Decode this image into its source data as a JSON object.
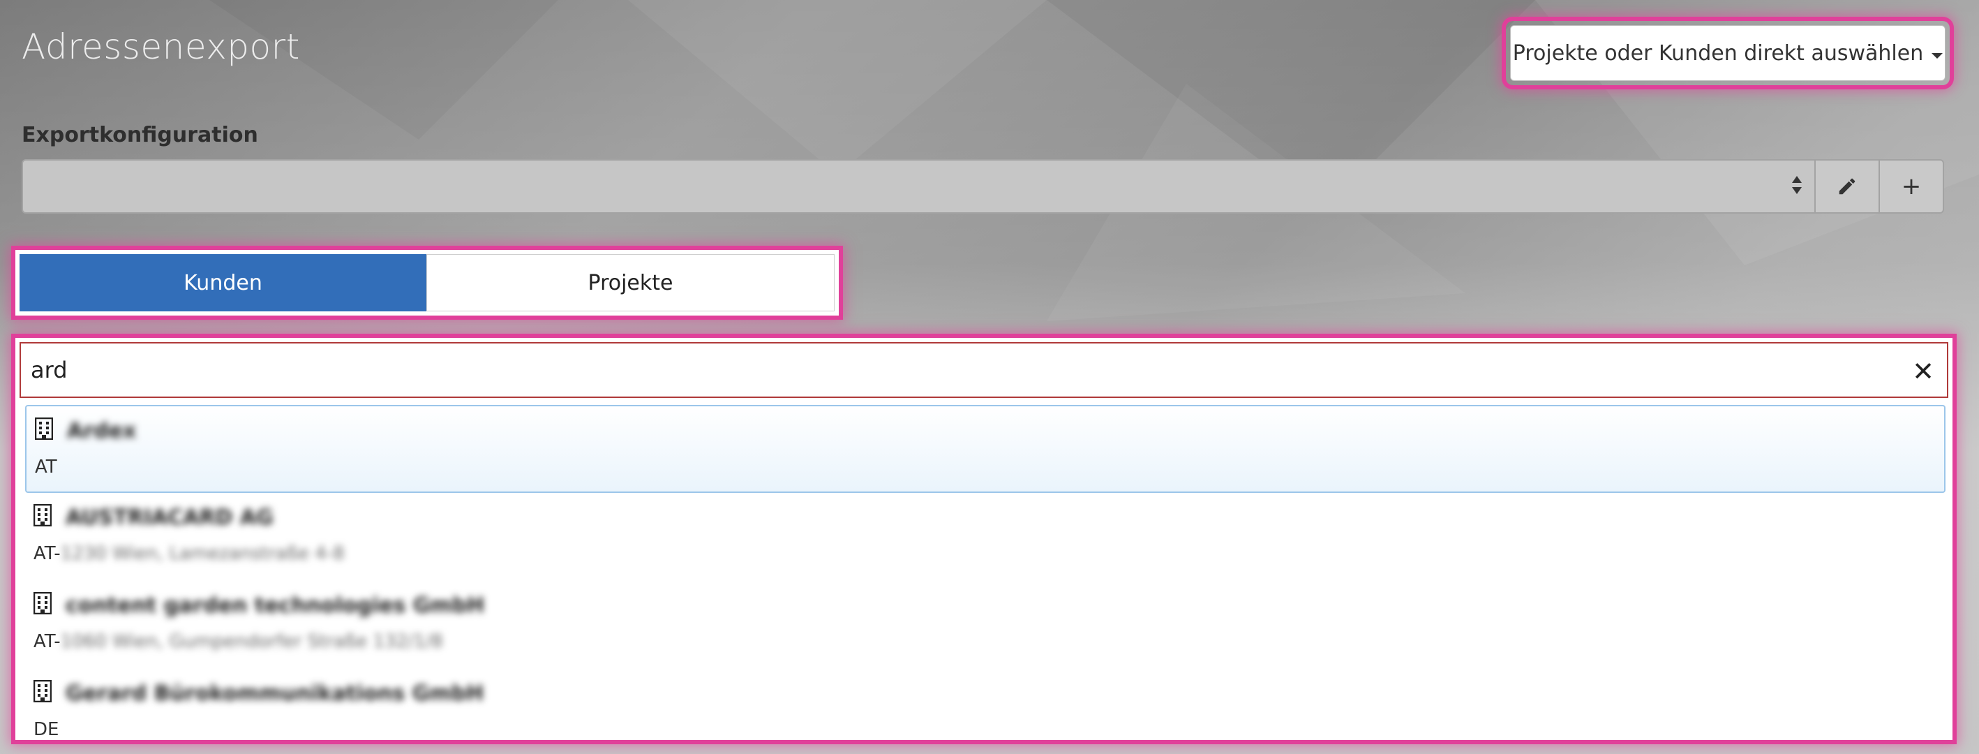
{
  "page": {
    "title": "Adressenexport"
  },
  "direct_select": {
    "label": "Projekte oder Kunden direkt auswählen"
  },
  "export_config": {
    "label": "Exportkonfiguration",
    "selected_value": "",
    "edit_icon": "pencil-icon",
    "add_label": "+"
  },
  "tabs": [
    {
      "label": "Kunden",
      "active": true
    },
    {
      "label": "Projekte",
      "active": false
    }
  ],
  "search": {
    "value": "ard",
    "clear_label": "✕"
  },
  "results": [
    {
      "name": "Ardex",
      "country": "AT",
      "address": "",
      "icon": "building-icon"
    },
    {
      "name": "AUSTRIACARD AG",
      "country": "AT-",
      "address": "1230 Wien, Lamezanstraße 4-8",
      "icon": "building-icon"
    },
    {
      "name": "content garden technologies GmbH",
      "country": "AT-",
      "address": "1060 Wien, Gumpendorfer Straße 132/1/8",
      "icon": "building-icon"
    },
    {
      "name": "Gerard Bürokommunikations GmbH",
      "country": "DE",
      "address": "",
      "icon": "building-icon"
    }
  ],
  "colors": {
    "accent": "#326eb9",
    "highlight_outline": "#e0409a",
    "error_border": "#b03a3a"
  }
}
